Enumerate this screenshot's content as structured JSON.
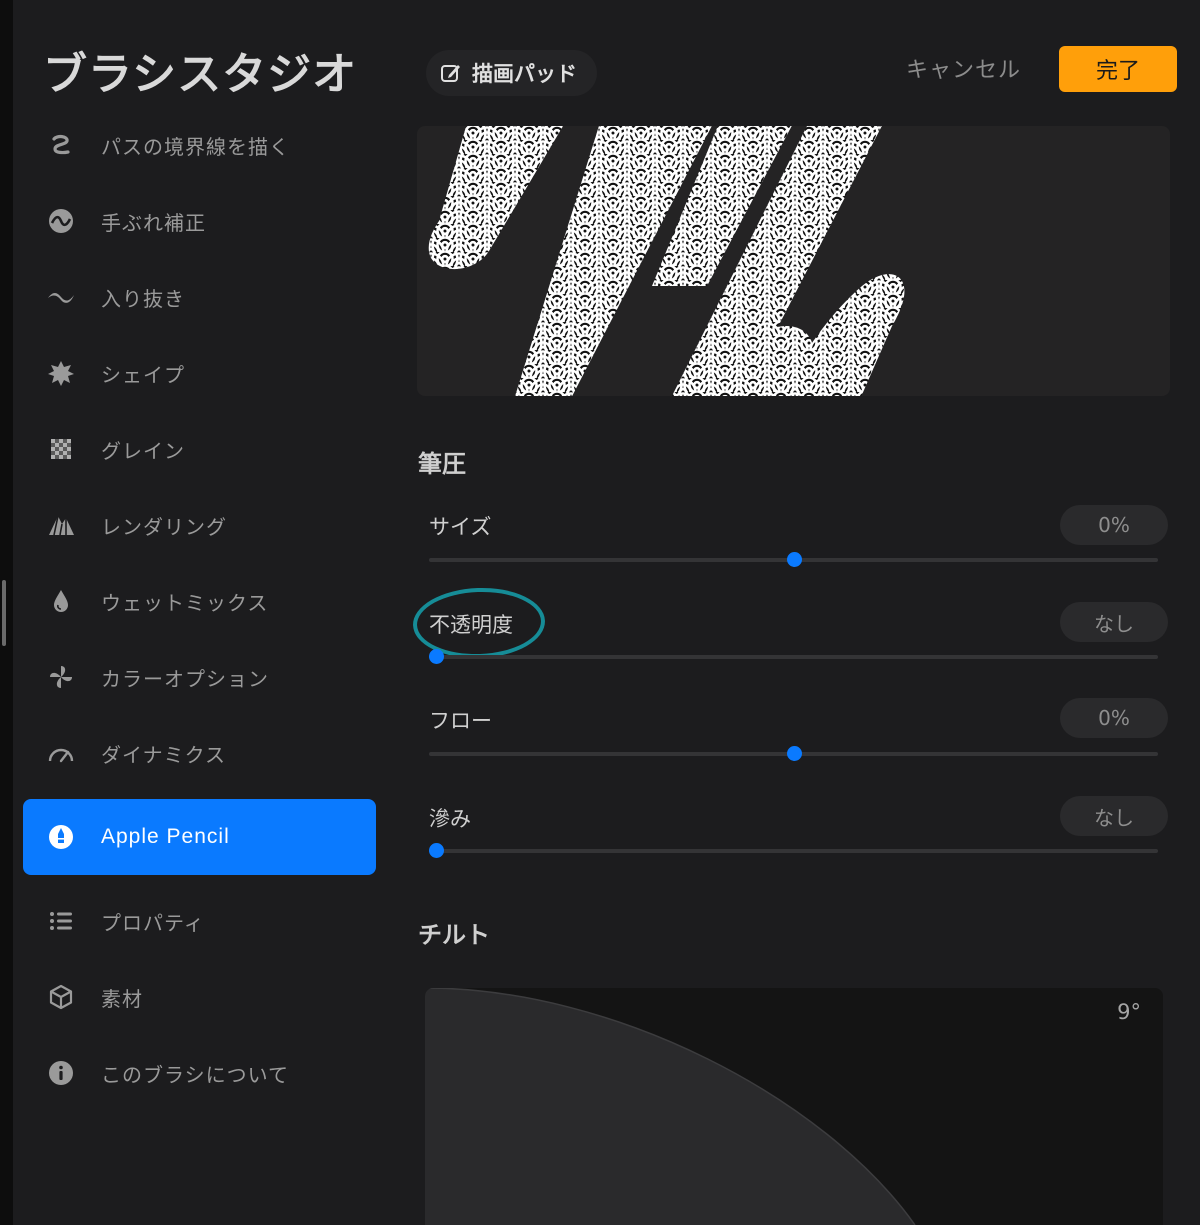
{
  "sidebar": {
    "title": "ブラシスタジオ",
    "items": [
      {
        "label": "パスの境界線を描く",
        "icon": "stroke-path-icon"
      },
      {
        "label": "手ぶれ補正",
        "icon": "stabilization-icon"
      },
      {
        "label": "入り抜き",
        "icon": "taper-icon"
      },
      {
        "label": "シェイプ",
        "icon": "shape-icon"
      },
      {
        "label": "グレイン",
        "icon": "grain-icon"
      },
      {
        "label": "レンダリング",
        "icon": "rendering-icon"
      },
      {
        "label": "ウェットミックス",
        "icon": "wet-mix-icon"
      },
      {
        "label": "カラーオプション",
        "icon": "color-options-icon"
      },
      {
        "label": "ダイナミクス",
        "icon": "dynamics-icon"
      },
      {
        "label": "Apple Pencil",
        "icon": "apple-pencil-icon",
        "active": true
      },
      {
        "label": "プロパティ",
        "icon": "properties-icon"
      },
      {
        "label": "素材",
        "icon": "materials-icon"
      },
      {
        "label": "このブラシについて",
        "icon": "about-icon"
      }
    ]
  },
  "header": {
    "drawing_pad_label": "描画パッド",
    "drawing_pad_icon": "edit-icon",
    "cancel_label": "キャンセル",
    "done_label": "完了"
  },
  "pressure": {
    "title": "筆圧",
    "rows": [
      {
        "label": "サイズ",
        "value": "0%",
        "slider": 0.5
      },
      {
        "label": "不透明度",
        "value": "なし",
        "slider": 0.0
      },
      {
        "label": "フロー",
        "value": "0%",
        "slider": 0.5
      },
      {
        "label": "滲み",
        "value": "なし",
        "slider": 0.0
      }
    ]
  },
  "tilt": {
    "title": "チルト",
    "angle": "9°"
  },
  "colors": {
    "accent": "#0a7aff",
    "done": "#ff9f0a",
    "annotation": "#168c97"
  }
}
